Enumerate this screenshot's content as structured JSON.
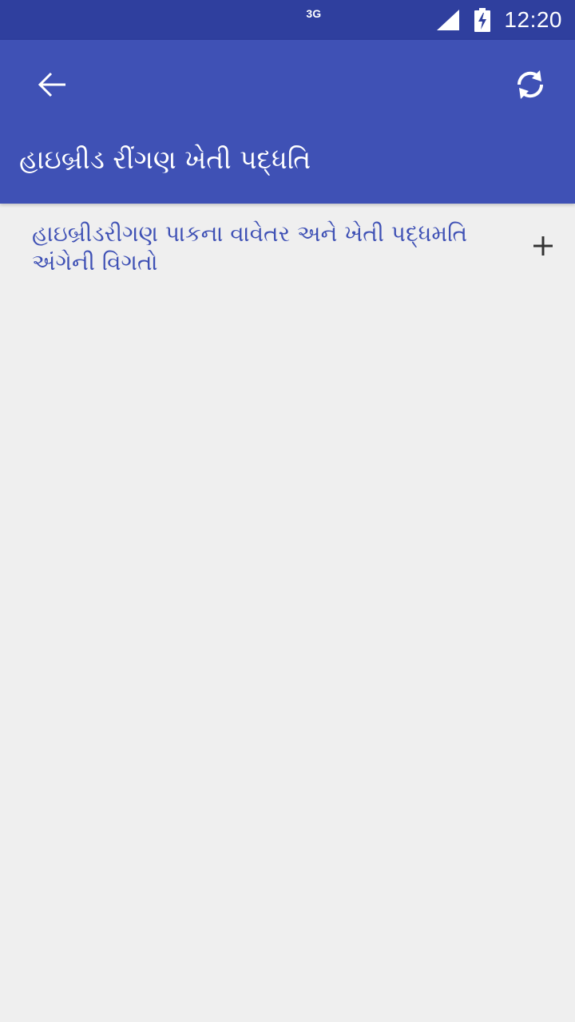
{
  "status_bar": {
    "network_type": "3G",
    "time": "12:20",
    "icons": [
      "signal-icon",
      "battery-charging-icon"
    ]
  },
  "app_bar": {
    "title": "હાઇબ્રીડ રીંગણ ખેતી પદ્ધતિ",
    "icons": [
      "back-arrow-icon",
      "refresh-icon"
    ]
  },
  "content": {
    "items": [
      {
        "text": "હાઇબ્રીડરીગણ પાકના વાવેતર અને ખેતી પદ્ધમતિ અંગેની વિગતો",
        "icon": "plus-icon"
      }
    ]
  },
  "colors": {
    "status_bar": "#2f3f9e",
    "app_bar": "#3f51b5",
    "background": "#efefef",
    "link_text": "#3f51b5"
  }
}
